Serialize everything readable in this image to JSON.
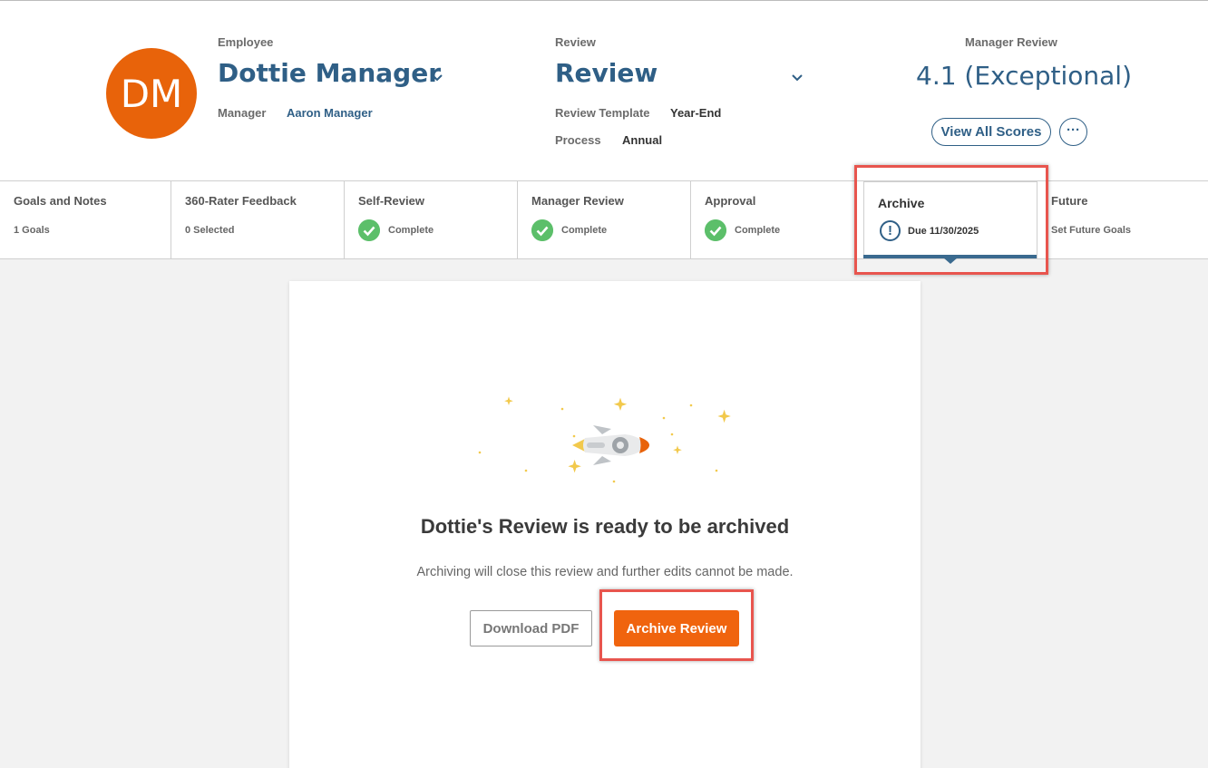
{
  "employee": {
    "label": "Employee",
    "initials": "DM",
    "name": "Dottie Manager",
    "manager_label": "Manager",
    "manager_value": "Aaron Manager",
    "avatar_color": "#e8630a"
  },
  "review": {
    "label": "Review",
    "title": "Review",
    "template_label": "Review Template",
    "template_value": "Year-End",
    "process_label": "Process",
    "process_value": "Annual"
  },
  "manager_review": {
    "label": "Manager Review",
    "score": "4.1 (Exceptional)",
    "view_all_label": "View All Scores",
    "more_label": "···"
  },
  "steps": [
    {
      "title": "Goals and Notes",
      "sub": "1 Goals",
      "status": "none"
    },
    {
      "title": "360-Rater Feedback",
      "sub": "0 Selected",
      "status": "none"
    },
    {
      "title": "Self-Review",
      "sub": "Complete",
      "status": "complete"
    },
    {
      "title": "Manager Review",
      "sub": "Complete",
      "status": "complete"
    },
    {
      "title": "Approval",
      "sub": "Complete",
      "status": "complete"
    },
    {
      "title": "Archive",
      "sub": "Due 11/30/2025",
      "status": "due",
      "active": true
    },
    {
      "title": "Future",
      "sub": "Set Future Goals",
      "status": "none"
    }
  ],
  "archive_panel": {
    "title": "Dottie's Review is ready to be archived",
    "subtitle": "Archiving will close this review and further edits cannot be made.",
    "download_label": "Download PDF",
    "archive_label": "Archive Review"
  },
  "colors": {
    "accent": "#2f5f86",
    "orange": "#f0640e",
    "complete": "#5cbf6a",
    "highlight": "#e8554e"
  },
  "icons": {
    "employee_chevron": "chevron-down-icon",
    "review_chevron": "chevron-down-icon",
    "complete": "check-circle-icon",
    "due": "exclamation-circle-icon",
    "illustration": "rocket-illustration"
  }
}
